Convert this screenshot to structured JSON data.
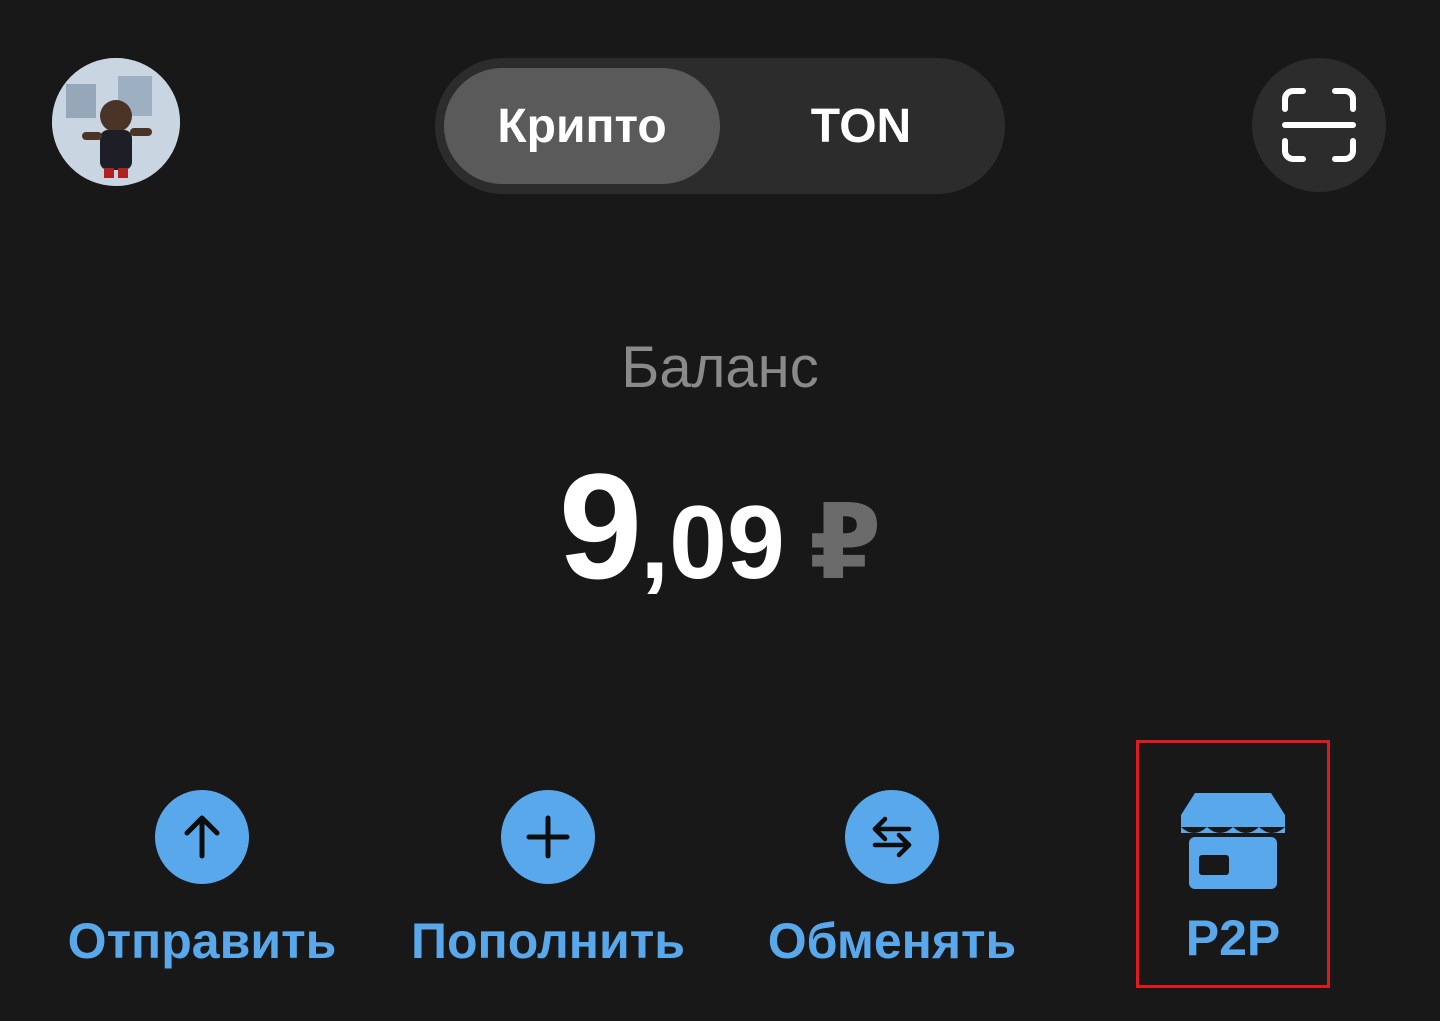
{
  "header": {
    "tabs": [
      {
        "label": "Крипто",
        "active": true
      },
      {
        "label": "TON",
        "active": false
      }
    ]
  },
  "balance": {
    "label": "Баланс",
    "integer_part": "9",
    "fraction_part": ",09",
    "currency": "₽"
  },
  "actions": [
    {
      "label": "Отправить",
      "icon": "arrow-up-icon"
    },
    {
      "label": "Пополнить",
      "icon": "plus-icon"
    },
    {
      "label": "Обменять",
      "icon": "exchange-arrows-icon"
    },
    {
      "label": "P2P",
      "icon": "store-icon",
      "highlighted": true
    }
  ],
  "colors": {
    "background": "#181818",
    "accent": "#5aa8ec",
    "highlight_border": "#e0191f"
  }
}
